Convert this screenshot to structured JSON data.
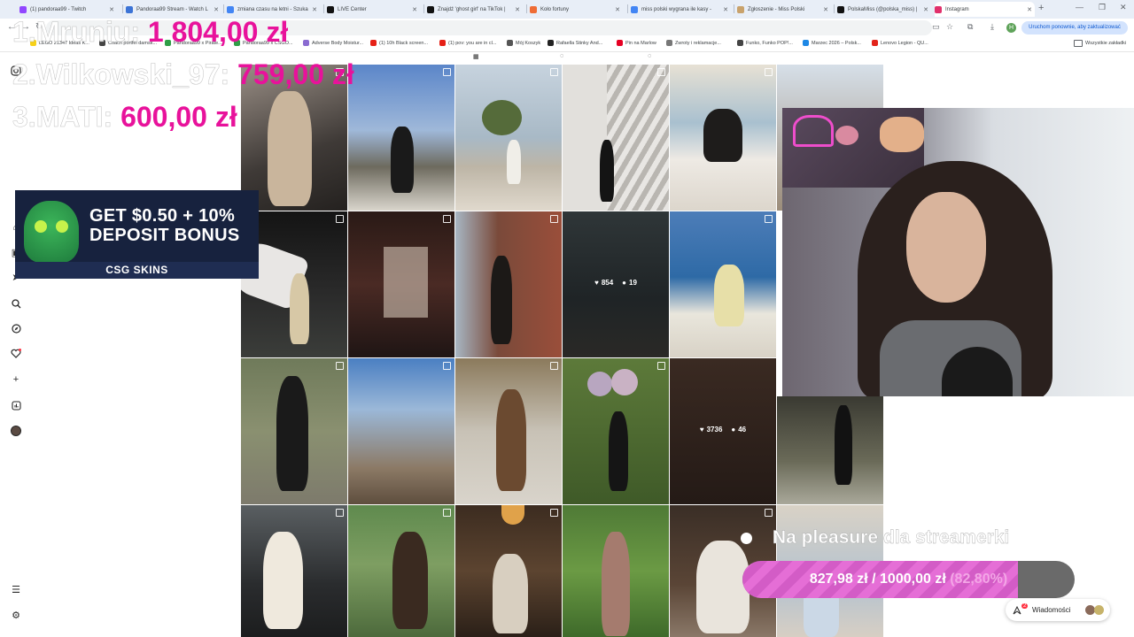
{
  "browser": {
    "tabs": [
      {
        "title": "(1) pandoraa99 - Twitch",
        "color": "#9146ff"
      },
      {
        "title": "Pandoraa99 Stream - Watch L",
        "color": "#3b73d6"
      },
      {
        "title": "zmiana czasu na letni - Szuka",
        "color": "#4285f4"
      },
      {
        "title": "LIVE Center",
        "color": "#111111"
      },
      {
        "title": "Znajdź 'ghost girl' na TikTok | ",
        "color": "#111111"
      },
      {
        "title": "Koło fortuny",
        "color": "#ef6c35"
      },
      {
        "title": "miss polski wygrana ile kasy - ",
        "color": "#4285f4"
      },
      {
        "title": "Zgłoszenie - Miss Polski",
        "color": "#c9a26b"
      },
      {
        "title": "PolskaMiss (@polska_miss) | ",
        "color": "#111111"
      },
      {
        "title": "Instagram",
        "color": "#e1306c"
      }
    ],
    "update_button": "Uruchom ponownie, aby zaktualizować",
    "profile_letter": "H",
    "bookmarks": [
      {
        "label": "LEGO 21347 Ideas K...",
        "color": "#f7d117"
      },
      {
        "label": "Coach portfel damsk...",
        "color": "#444444"
      },
      {
        "label": "Pandoraa99 x Pirate...",
        "color": "#2e9e46"
      },
      {
        "label": "Pandoraa99 x CSGO...",
        "color": "#2e9e46"
      },
      {
        "label": "Adverse Body Moistur...",
        "color": "#8a6bd1"
      },
      {
        "label": "(1) 10h Black screen...",
        "color": "#e62117"
      },
      {
        "label": "(1) pov: you are in cl...",
        "color": "#e62117"
      },
      {
        "label": "Mój Koszyk",
        "color": "#555555"
      },
      {
        "label": "Rafaella Stinky And...",
        "color": "#222222"
      },
      {
        "label": "Pin na Marlow",
        "color": "#e60023"
      },
      {
        "label": "Zwroty i reklamacje...",
        "color": "#777777"
      },
      {
        "label": "Funko, Funko POP!...",
        "color": "#444444"
      },
      {
        "label": "Marzec 2026 – Polsk...",
        "color": "#1e88e5"
      },
      {
        "label": "Lenovo Legion - QU...",
        "color": "#e2231a"
      }
    ],
    "all_bookmarks": "Wszystkie zakładki"
  },
  "instagram": {
    "sidebar_icons": [
      "instagram-logo-icon",
      "home-icon",
      "reels-icon",
      "messages-icon",
      "search-icon",
      "explore-icon",
      "notifications-heart-icon",
      "create-plus-icon",
      "dashboard-icon",
      "profile-avatar-icon",
      "menu-icon",
      "also-from-meta-icon"
    ],
    "hover_stats": [
      {
        "likes": "854",
        "comments": "19"
      },
      {
        "likes": "3736",
        "comments": "46"
      }
    ],
    "messages_label": "Wiadomości",
    "messages_badge": "2"
  },
  "overlay": {
    "leaderboard": [
      {
        "name": "1.Mruniu:",
        "amount": "1 804,00 zł"
      },
      {
        "name": "2.Wilkowski_97:",
        "amount": "759,00 zł"
      },
      {
        "name": "3.MATI:",
        "amount": "600,00 zł"
      }
    ],
    "ad": {
      "line1": "GET $0.50 + 10%",
      "line2": "DEPOSIT BONUS",
      "brand": "CSG SKINS"
    },
    "goal": {
      "title": "Na pleasure dla streamerki",
      "current": "827,98 zł",
      "separator": "/",
      "target": "1000,00 zł",
      "percent": "(82,80%)",
      "progress_fraction": 0.828
    }
  }
}
